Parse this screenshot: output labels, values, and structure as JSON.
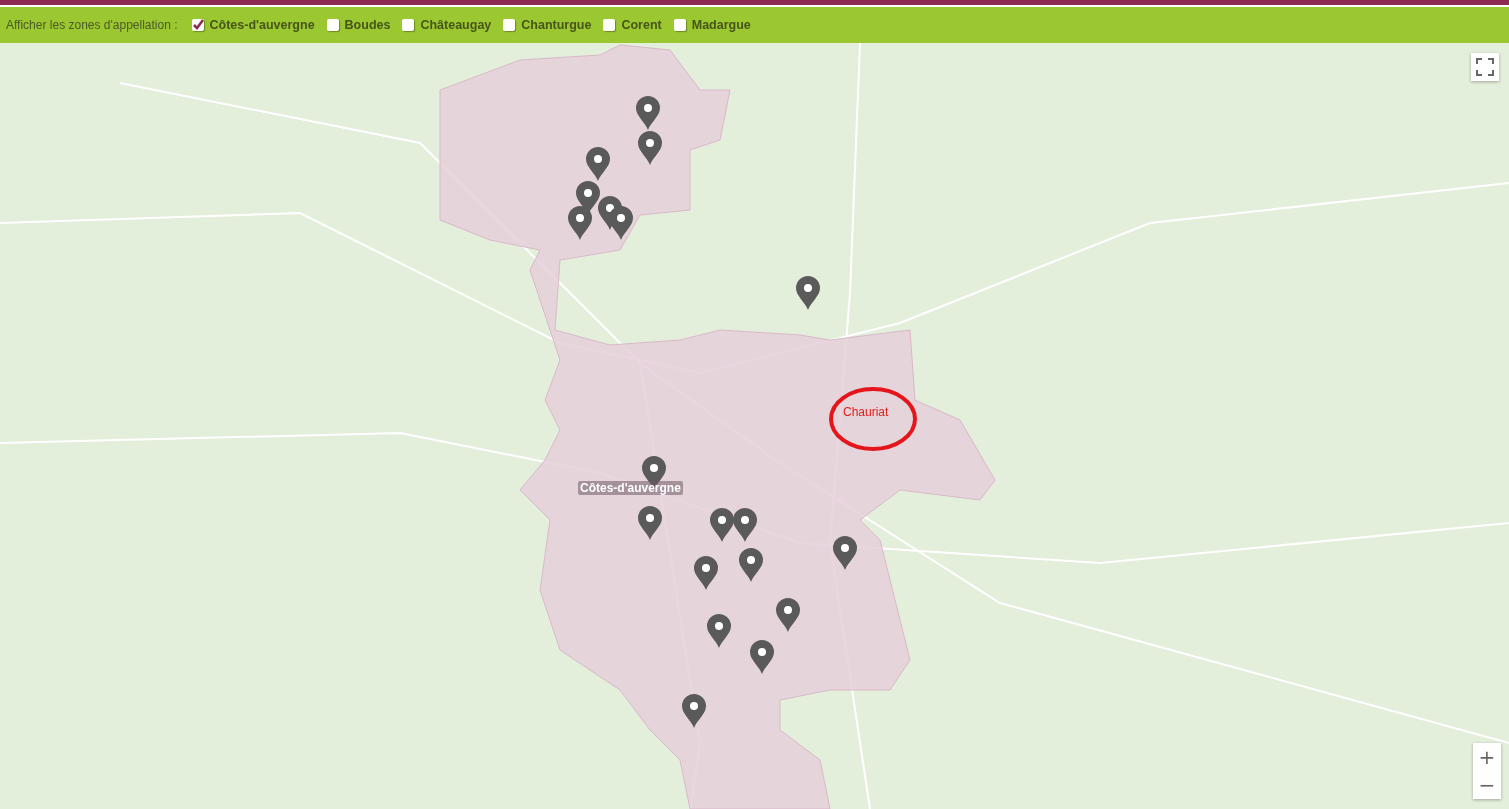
{
  "filter_bar": {
    "label": "Afficher les zones d'appellation :",
    "options": [
      {
        "label": "Côtes-d'auvergne",
        "checked": true
      },
      {
        "label": "Boudes",
        "checked": false
      },
      {
        "label": "Châteaugay",
        "checked": false
      },
      {
        "label": "Chanturgue",
        "checked": false
      },
      {
        "label": "Corent",
        "checked": false
      },
      {
        "label": "Madargue",
        "checked": false
      }
    ]
  },
  "map": {
    "zone_label": "Côtes-d'auvergne",
    "annotation": "Chauriat",
    "zoom_in": "+",
    "zoom_out": "−"
  }
}
